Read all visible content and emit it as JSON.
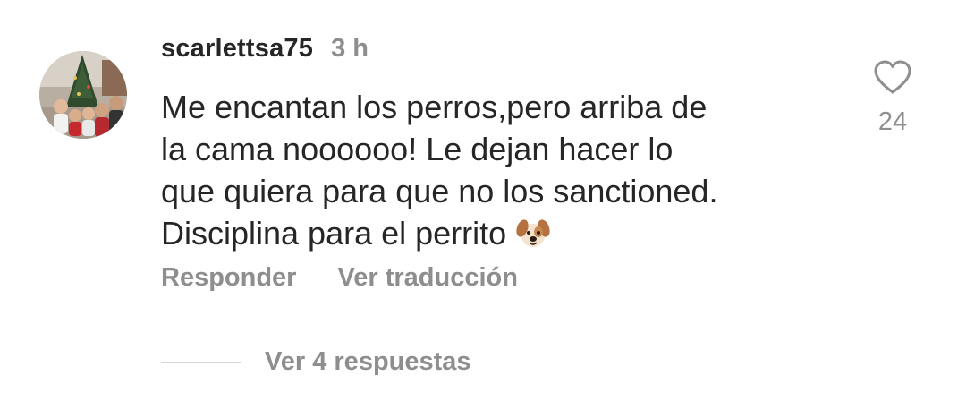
{
  "comment": {
    "username": "scarlettsa75",
    "time_ago": "3 h",
    "text": "Me encantan los perros,pero arriba de\nla cama noooooo! Le dejan hacer lo\nque quiera para que no los sanctioned.\nDisciplina para el perrito",
    "emoji": "dog-face-emoji",
    "avatar": "profile-photo-family-christmas-tree"
  },
  "actions": {
    "reply_label": "Responder",
    "translate_label": "Ver traducción"
  },
  "like": {
    "icon": "heart-outline-icon",
    "count": "24"
  },
  "replies": {
    "label": "Ver 4 respuestas"
  },
  "colors": {
    "primary_text": "#262626",
    "secondary_text": "#8e8e8e",
    "divider": "#d6d6d6",
    "background": "#ffffff"
  }
}
